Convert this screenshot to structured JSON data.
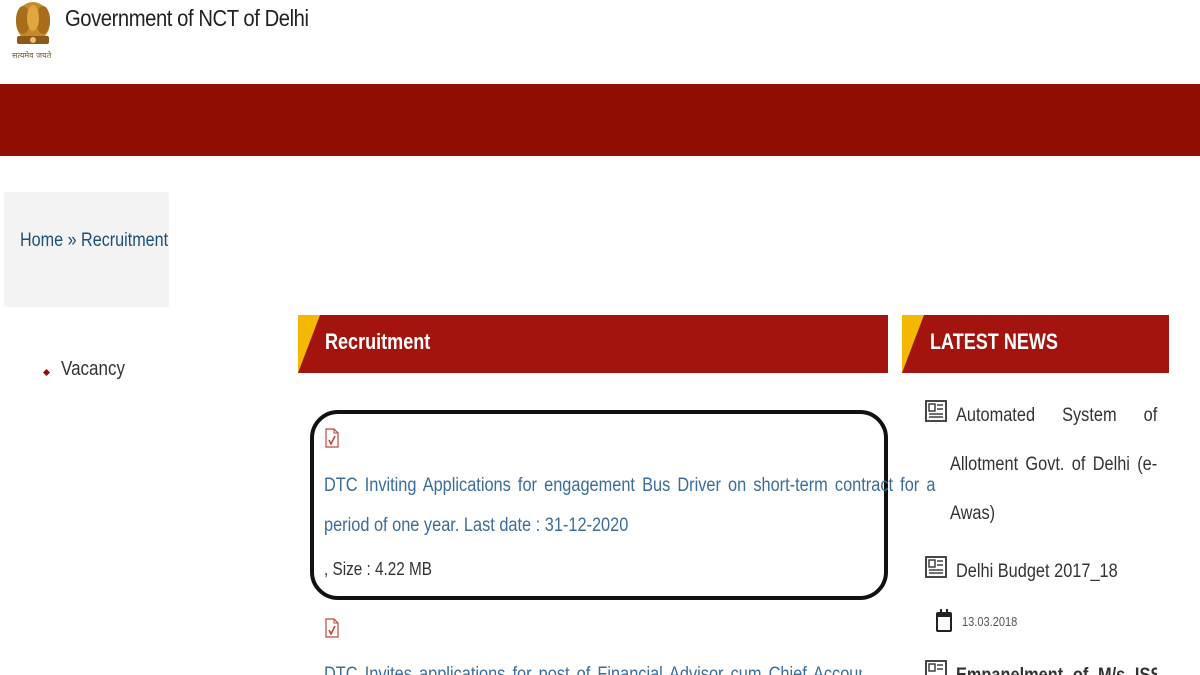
{
  "header": {
    "site_title": "Government of NCT of Delhi",
    "emblem_motto": "सत्यमेव जयते"
  },
  "breadcrumb": {
    "home": "Home",
    "separator": "»",
    "current": "Recruitment"
  },
  "sidebar": {
    "items": [
      {
        "label": "Vacancy"
      }
    ]
  },
  "recruitment": {
    "title": "Recruitment",
    "documents": [
      {
        "line1": "DTC Inviting Applications for engagement Bus Driver on short-term contract for a",
        "line2": "period of one year. Last date : 31-12-2020",
        "size": ", Size : 4.22 MB"
      },
      {
        "line1": "DTC Invites applications for post of Financial Advisor cum Chief Accounts Officer on"
      }
    ]
  },
  "latest_news": {
    "title": "LATEST NEWS",
    "items": [
      {
        "words": [
          "Automated",
          "System",
          "of"
        ],
        "line2": [
          "Allotment",
          "Govt.",
          "of",
          "Delhi",
          "(e-"
        ],
        "line3": "Awas)"
      },
      {
        "text": "Delhi Budget 2017_18",
        "date": "13.03.2018"
      },
      {
        "text": "Empanelment of M/s ISSIL for"
      }
    ]
  },
  "colors": {
    "brand_red": "#900d04",
    "header_red": "#a3140f",
    "accent_yellow": "#f5b800",
    "link_blue": "#3a6d9a"
  }
}
